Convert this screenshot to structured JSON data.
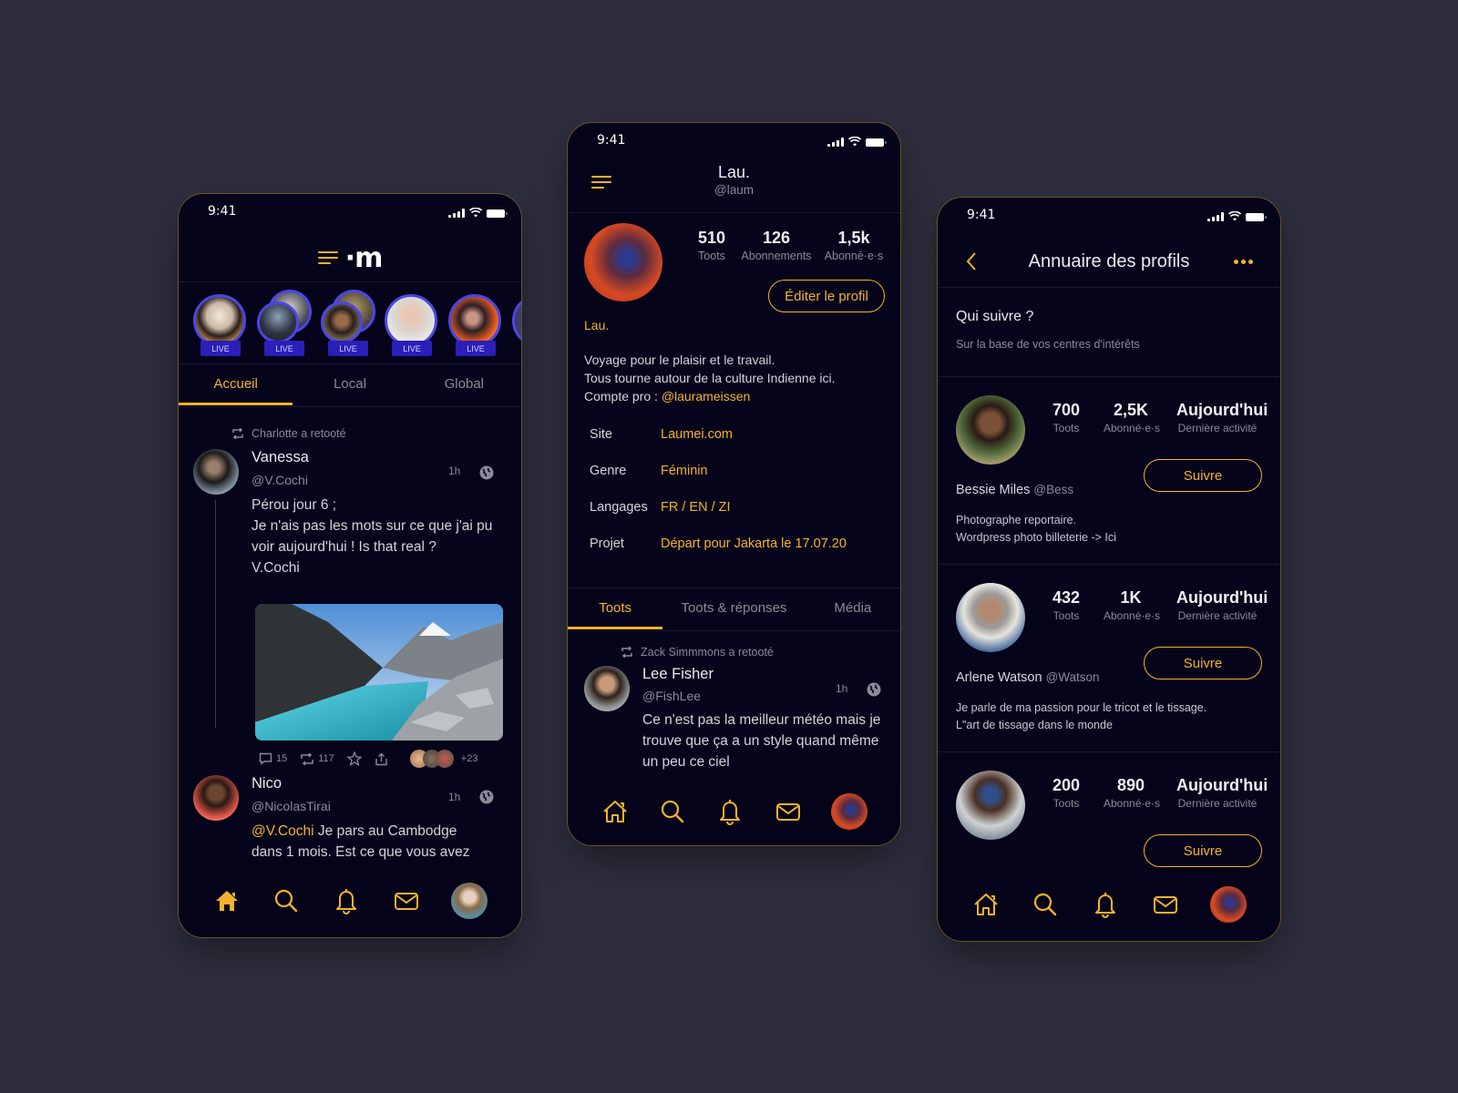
{
  "colors": {
    "background": "#2e2e3e",
    "phone_bg": "#05041a",
    "accent": "#f5b22c",
    "live_badge": "#2a1fb8",
    "story_ring": "#4b46e6",
    "muted_text": "#8b8a99"
  },
  "phone1": {
    "status_time": "9:41",
    "logo_text": "·m",
    "stories": [
      {
        "badge": "LIVE",
        "avatar": "woman-orange-dress-avatar"
      },
      {
        "badge": "LIVE",
        "avatar": "group-cyclist-avatar"
      },
      {
        "badge": "LIVE",
        "avatar": "group-woman-curly-avatar"
      },
      {
        "badge": "LIVE",
        "avatar": "woman-short-hair-avatar"
      },
      {
        "badge": "LIVE",
        "avatar": "woman-red-jacket-avatar"
      }
    ],
    "tabs": [
      {
        "label": "Accueil",
        "active": true
      },
      {
        "label": "Local",
        "active": false
      },
      {
        "label": "Global",
        "active": false
      }
    ],
    "posts": [
      {
        "reblog": "Charlotte a retooté",
        "name": "Vanessa",
        "handle": "@V.Cochi",
        "time": "1h",
        "text_lines": [
          "Pérou jour 6 ;",
          "Je n'ais pas les mots sur ce que j'ai pu",
          "voir aujourd'hui ! Is that real ?",
          "V.Cochi"
        ],
        "image": "mountain-lake-photo",
        "replies": "15",
        "reblogs": "117",
        "extra_likers": "+23"
      },
      {
        "name": "Nico",
        "handle": "@NicolasTirai",
        "time": "1h",
        "mention": "@V.Cochi",
        "text_line1": " Je pars au Cambodge",
        "text_line2": "dans 1 mois. Est ce que vous avez"
      }
    ],
    "nav": [
      "home",
      "search",
      "notifications",
      "messages",
      "profile"
    ]
  },
  "phone2": {
    "status_time": "9:41",
    "name": "Lau.",
    "handle": "@laum",
    "stats": [
      {
        "value": "510",
        "label": "Toots"
      },
      {
        "value": "126",
        "label": "Abonnements"
      },
      {
        "value": "1,5k",
        "label": "Abonné·e·s"
      }
    ],
    "edit_button": "Éditer le profil",
    "display_name": "Lau.",
    "bio_lines": [
      "Voyage pour le plaisir et le travail.",
      "Tous tourne autour de la culture Indienne ici."
    ],
    "bio_pro_prefix": "Compte pro : ",
    "bio_pro_handle": "@laurameissen",
    "fields": [
      {
        "key": "Site",
        "value": "Laumei.com"
      },
      {
        "key": "Genre",
        "value": "Féminin"
      },
      {
        "key": "Langages",
        "value": "FR / EN / ZI"
      },
      {
        "key": "Projet",
        "value": "Départ pour Jakarta le 17.07.20"
      }
    ],
    "tabs": [
      {
        "label": "Toots",
        "active": true
      },
      {
        "label": "Toots & réponses",
        "active": false
      },
      {
        "label": "Média",
        "active": false
      }
    ],
    "post": {
      "reblog": "Zack Simmmons a retooté",
      "name": "Lee Fisher",
      "handle": "@FishLee",
      "time": "1h",
      "text_lines": [
        "Ce n'est pas la meilleur météo mais je",
        "trouve que ça a un style quand même",
        "un peu ce ciel"
      ]
    }
  },
  "phone3": {
    "status_time": "9:41",
    "title": "Annuaire des profils",
    "section_title": "Qui suivre ?",
    "section_sub": "Sur la base de vos centres d'intérêts",
    "profiles": [
      {
        "toots": "700",
        "toots_label": "Toots",
        "followers": "2,5K",
        "followers_label": "Abonné·e·s",
        "last": "Aujourd'hui",
        "last_label": "Dernière activité",
        "follow": "Suivre",
        "name": "Bessie Miles",
        "handle": "@Bess",
        "bio_lines": [
          "Photographe reportaire.",
          "Wordpress photo billeterie -> Ici"
        ]
      },
      {
        "toots": "432",
        "toots_label": "Toots",
        "followers": "1K",
        "followers_label": "Abonné·e·s",
        "last": "Aujourd'hui",
        "last_label": "Dernière activité",
        "follow": "Suivre",
        "name": "Arlene Watson",
        "handle": "@Watson",
        "bio_lines": [
          "Je parle de ma passion pour le tricot et le tissage.",
          "L\"art de tissage dans le monde"
        ]
      },
      {
        "toots": "200",
        "toots_label": "Toots",
        "followers": "890",
        "followers_label": "Abonné·e·s",
        "last": "Aujourd'hui",
        "last_label": "Dernière activité",
        "follow": "Suivre"
      }
    ]
  }
}
